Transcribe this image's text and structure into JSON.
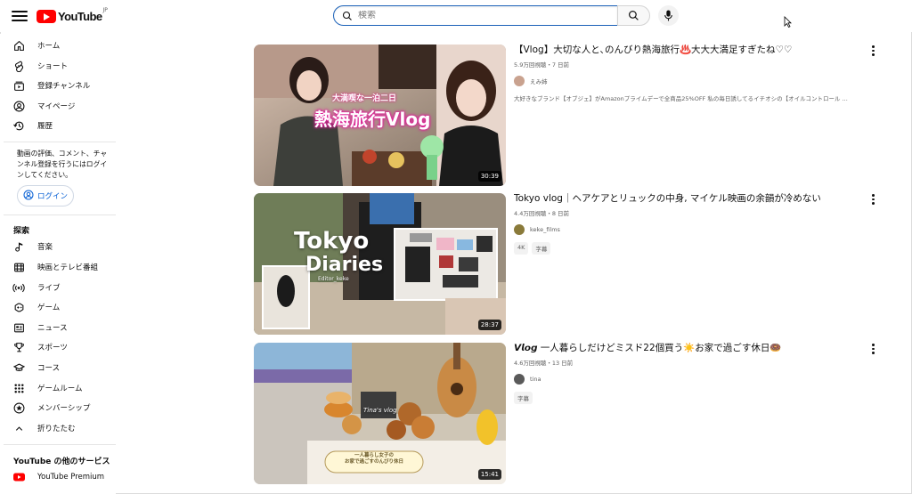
{
  "header": {
    "logo_text": "YouTube",
    "region": "JP",
    "search_placeholder": "検索"
  },
  "sidebar": {
    "main": [
      {
        "label": "ホーム",
        "icon": "home-icon"
      },
      {
        "label": "ショート",
        "icon": "shorts-icon"
      },
      {
        "label": "登録チャンネル",
        "icon": "subscriptions-icon"
      },
      {
        "label": "マイページ",
        "icon": "account-icon"
      },
      {
        "label": "履歴",
        "icon": "history-icon"
      }
    ],
    "signin_prompt": "動画の評価、コメント、チャンネル登録を行うにはログインしてください。",
    "login_label": "ログイン",
    "explore_title": "探索",
    "explore": [
      {
        "label": "音楽",
        "icon": "music-icon"
      },
      {
        "label": "映画とテレビ番組",
        "icon": "movies-icon"
      },
      {
        "label": "ライブ",
        "icon": "live-icon"
      },
      {
        "label": "ゲーム",
        "icon": "gaming-icon"
      },
      {
        "label": "ニュース",
        "icon": "news-icon"
      },
      {
        "label": "スポーツ",
        "icon": "sports-icon"
      },
      {
        "label": "コース",
        "icon": "courses-icon"
      },
      {
        "label": "ゲームルーム",
        "icon": "playables-icon"
      },
      {
        "label": "メンバーシップ",
        "icon": "membership-icon"
      },
      {
        "label": "折りたたむ",
        "icon": "chevron-up-icon"
      }
    ],
    "more_title": "YouTube の他のサービス",
    "more": [
      {
        "label": "YouTube Premium",
        "icon": "youtube-premium-icon"
      }
    ]
  },
  "videos": [
    {
      "title": "【Vlog】大切な人と､のんびり熱海旅行♨️大大大満足すぎたね♡♡",
      "meta": "5.9万回視聴・7 日前",
      "channel": "えみ姉",
      "description": "大好きなブランド【オブジェ】がAmazonプライムデーで全商品25%OFF 私の毎日誘してるイチオシの【オイルコントロール ...",
      "duration": "30:39",
      "badges": [],
      "thumb_caption_top": "大満喫な一泊二日",
      "thumb_caption": "熱海旅行Vlog"
    },
    {
      "title": "Tokyo vlog｜ヘアケアとリュックの中身, マイケル映画の余韻が冷めない",
      "meta": "4.4万回視聴・8 日前",
      "channel": "keke_films",
      "description": "",
      "duration": "28:37",
      "badges": [
        "4K",
        "字幕"
      ],
      "thumb_caption_top": "Tokyo",
      "thumb_caption": "Diaries",
      "thumb_caption_sub": "Editor_keke"
    },
    {
      "title": "𝙑𝙡𝙤𝙜 一人暮らしだけどミスド22個買う☀️お家で過ごす休日🍩",
      "meta": "4.6万回視聴・13 日前",
      "channel": "tina",
      "description": "",
      "duration": "15:41",
      "badges": [
        "字幕"
      ],
      "thumb_caption_top": "Tina's vlog",
      "thumb_caption": "一人暮らし女子の\nお家で過ごすのんびり休日"
    }
  ],
  "colors": {
    "brand": "#ff0000",
    "link": "#065fd4",
    "text": "#0f0f0f",
    "meta": "#606060"
  }
}
